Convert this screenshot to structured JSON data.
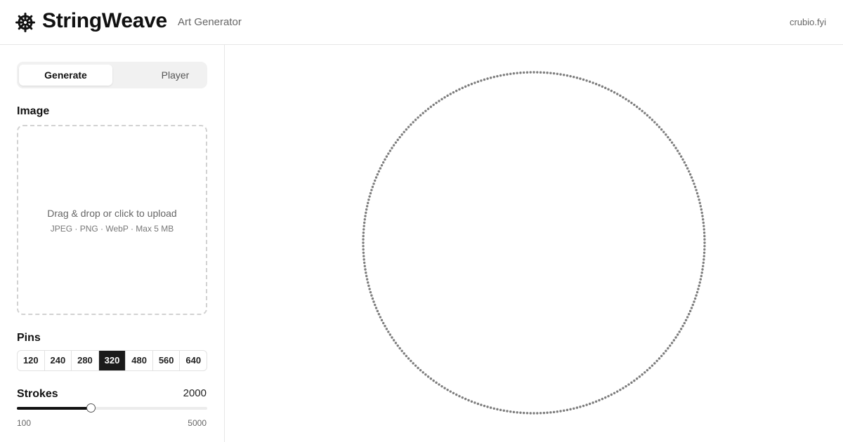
{
  "header": {
    "title": "StringWeave",
    "subtitle": "Art Generator",
    "site_link": "crubio.fyi",
    "logo_icon": "helm-wheel-icon"
  },
  "sidebar": {
    "tabs": [
      {
        "label": "Generate",
        "active": true
      },
      {
        "label": "Player",
        "active": false
      }
    ],
    "image_section": {
      "label": "Image",
      "dropzone_text": "Drag & drop or click to upload",
      "dropzone_hint": "JPEG · PNG · WebP · Max 5 MB"
    },
    "pins_section": {
      "label": "Pins",
      "options": [
        "120",
        "240",
        "280",
        "320",
        "480",
        "560",
        "640"
      ],
      "selected": "320"
    },
    "strokes_section": {
      "label": "Strokes",
      "value": "2000",
      "min": "100",
      "max": "5000",
      "current": 2000
    }
  },
  "canvas": {
    "pin_count": 320,
    "pin_color": "#7d7d7d"
  },
  "colors": {
    "accent": "#1b1b1b",
    "border": "#e6e6e6",
    "muted_text": "#666666"
  }
}
